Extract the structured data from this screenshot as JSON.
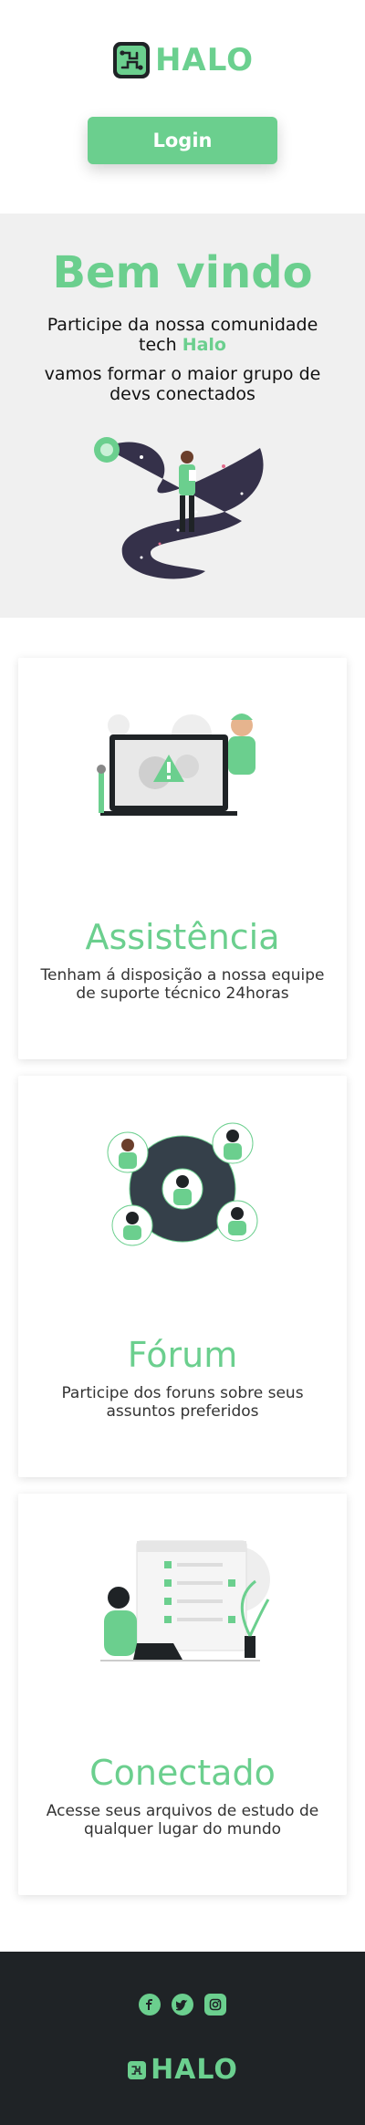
{
  "header": {
    "logo_text": "HALO",
    "login_label": "Login"
  },
  "hero": {
    "title": "Bem vindo",
    "line1": "Participe da nossa comunidade",
    "line2_prefix": "tech",
    "line2_brand": "Halo",
    "line3": "vamos formar o maior grupo de",
    "line4": "devs conectados"
  },
  "cards": [
    {
      "title": "Assistência",
      "text": "Tenham á disposição a nossa equipe de suporte técnico 24horas",
      "illustration": "support-technician-illustration"
    },
    {
      "title": "Fórum",
      "text": "Participe dos foruns sobre seus assuntos preferidos",
      "illustration": "forum-community-illustration"
    },
    {
      "title": "Conectado",
      "text": "Acesse seus arquivos de estudo de qualquer lugar do mundo",
      "illustration": "connected-files-illustration"
    }
  ],
  "footer": {
    "logo_text": "HALO",
    "social": [
      "facebook-icon",
      "twitter-icon",
      "instagram-icon"
    ]
  },
  "colors": {
    "accent": "#6bcf8e",
    "footer_bg": "#1f2326",
    "hero_bg": "#f0f0f0"
  }
}
